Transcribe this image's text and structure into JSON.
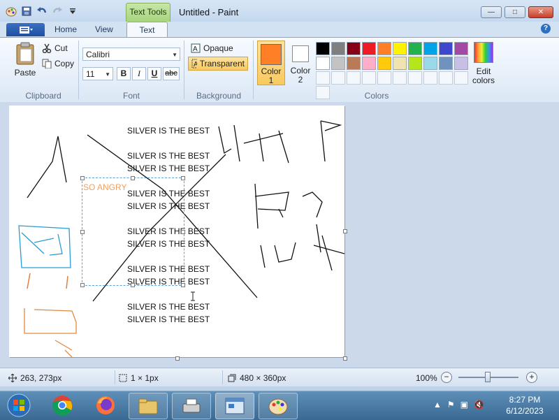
{
  "window": {
    "title": "Untitled - Paint",
    "context_tab": "Text Tools",
    "controls": {
      "minimize": "—",
      "maximize": "□",
      "close": "✕"
    }
  },
  "tabs": [
    {
      "label": "Home"
    },
    {
      "label": "View"
    },
    {
      "label": "Text",
      "active": true
    }
  ],
  "help_label": "?",
  "clipboard": {
    "paste_label": "Paste",
    "cut_label": "Cut",
    "copy_label": "Copy",
    "group_label": "Clipboard"
  },
  "font": {
    "family": "Calibri",
    "size": "11",
    "bold": "B",
    "italic": "I",
    "underline": "U",
    "strike": "abc",
    "group_label": "Font"
  },
  "background": {
    "opaque_label": "Opaque",
    "transparent_label": "Transparent",
    "group_label": "Background",
    "selected": "transparent"
  },
  "colors": {
    "color1_label": "Color",
    "color1_num": "1",
    "color2_label": "Color",
    "color2_num": "2",
    "color1_value": "#ff7f27",
    "color2_value": "#ffffff",
    "edit_colors_label": "Edit",
    "edit_colors_label2": "colors",
    "group_label": "Colors",
    "palette": [
      "#000000",
      "#7f7f7f",
      "#880015",
      "#ed1c24",
      "#ff7f27",
      "#fff200",
      "#22b14c",
      "#00a2e8",
      "#3f48cc",
      "#a349a4",
      "#ffffff",
      "#c3c3c3",
      "#b97a57",
      "#ffaec9",
      "#ffc90e",
      "#efe4b0",
      "#b5e61d",
      "#99d9ea",
      "#7092be",
      "#c8bfe7"
    ]
  },
  "canvas": {
    "lines": [
      "SILVER IS THE BEST",
      "SILVER IS THE BEST",
      "SILVER IS THE BEST",
      "SILVER IS THE BEST",
      "SILVER IS THE BEST",
      "SILVER IS THE BEST",
      "SILVER IS THE BEST",
      "SILVER IS THE BEST",
      "SILVER IS THE BEST",
      "SILVER IS THE BEST",
      "SILVER IS THE BEST"
    ],
    "angry_text": "SO ANGRY"
  },
  "status": {
    "cursor_pos": "263, 273px",
    "selection_size": "1 × 1px",
    "image_size": "480 × 360px",
    "zoom": "100%",
    "zoom_minus": "−",
    "zoom_plus": "+"
  },
  "taskbar": {
    "time": "8:27 PM",
    "date": "6/12/2023",
    "apps": [
      "start",
      "chrome",
      "firefox",
      "explorer",
      "scanner",
      "paint-window",
      "paint"
    ]
  }
}
